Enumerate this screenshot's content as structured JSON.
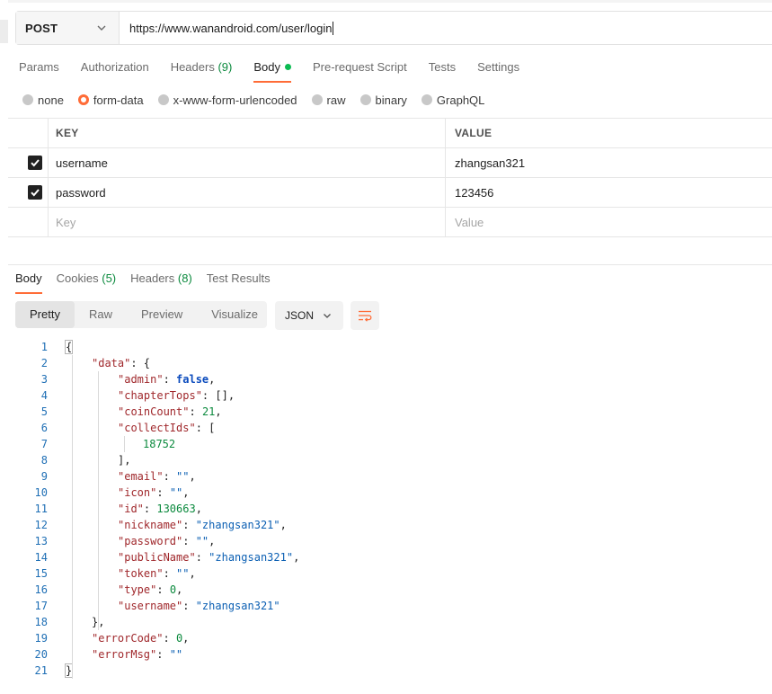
{
  "request": {
    "method": "POST",
    "url": "https://www.wanandroid.com/user/login"
  },
  "request_tabs": [
    {
      "label": "Params",
      "count": ""
    },
    {
      "label": "Authorization",
      "count": ""
    },
    {
      "label": "Headers",
      "count": "(9)"
    },
    {
      "label": "Body",
      "count": ""
    },
    {
      "label": "Pre-request Script",
      "count": ""
    },
    {
      "label": "Tests",
      "count": ""
    },
    {
      "label": "Settings",
      "count": ""
    }
  ],
  "body_types": [
    "none",
    "form-data",
    "x-www-form-urlencoded",
    "raw",
    "binary",
    "GraphQL"
  ],
  "selected_body_type": "form-data",
  "form_table": {
    "headers": {
      "key": "KEY",
      "value": "VALUE"
    },
    "rows": [
      {
        "key": "username",
        "value": "zhangsan321",
        "checked": true
      },
      {
        "key": "password",
        "value": "123456",
        "checked": true
      }
    ],
    "placeholder": {
      "key": "Key",
      "value": "Value"
    }
  },
  "response_tabs": [
    {
      "label": "Body",
      "count": ""
    },
    {
      "label": "Cookies",
      "count": "(5)"
    },
    {
      "label": "Headers",
      "count": "(8)"
    },
    {
      "label": "Test Results",
      "count": ""
    }
  ],
  "view_modes": [
    "Pretty",
    "Raw",
    "Preview",
    "Visualize"
  ],
  "format": "JSON",
  "colors": {
    "accent": "#ff6c37",
    "count_green": "#0c8a3e",
    "dot_green": "#0cbb52",
    "key_red": "#a0282c",
    "string_blue": "#0b5fb3"
  },
  "icons": {
    "method_dropdown": "chevron-down-icon",
    "format_dropdown": "chevron-down-icon",
    "wrap": "wrap-lines-icon",
    "checkbox": "check-icon"
  },
  "response_lines": [
    {
      "n": "1",
      "text": "{"
    },
    {
      "n": "2",
      "text": "\"data\": {"
    },
    {
      "n": "3",
      "text": "\"admin\": false,"
    },
    {
      "n": "4",
      "text": "\"chapterTops\": [],"
    },
    {
      "n": "5",
      "text": "\"coinCount\": 21,"
    },
    {
      "n": "6",
      "text": "\"collectIds\": ["
    },
    {
      "n": "7",
      "text": "18752"
    },
    {
      "n": "8",
      "text": "],"
    },
    {
      "n": "9",
      "text": "\"email\": \"\","
    },
    {
      "n": "10",
      "text": "\"icon\": \"\","
    },
    {
      "n": "11",
      "text": "\"id\": 130663,"
    },
    {
      "n": "12",
      "text": "\"nickname\": \"zhangsan321\","
    },
    {
      "n": "13",
      "text": "\"password\": \"\","
    },
    {
      "n": "14",
      "text": "\"publicName\": \"zhangsan321\","
    },
    {
      "n": "15",
      "text": "\"token\": \"\","
    },
    {
      "n": "16",
      "text": "\"type\": 0,"
    },
    {
      "n": "17",
      "text": "\"username\": \"zhangsan321\""
    },
    {
      "n": "18",
      "text": "},"
    },
    {
      "n": "19",
      "text": "\"errorCode\": 0,"
    },
    {
      "n": "20",
      "text": "\"errorMsg\": \"\""
    },
    {
      "n": "21",
      "text": "}"
    }
  ]
}
